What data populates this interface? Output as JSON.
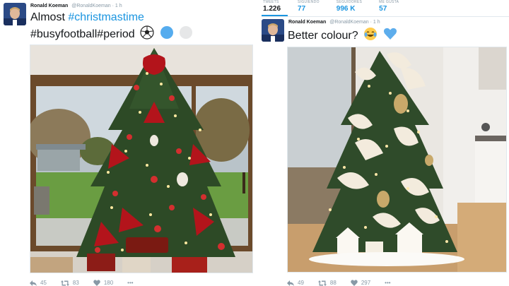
{
  "left_tweet": {
    "author_name": "Ronald Koeman",
    "author_handle": "@RonaldKoeman",
    "time": "· 1 h",
    "text_line1_plain": "Almost ",
    "text_line1_hashtag": "#christmastime",
    "text_line2": "#busyfootball#period",
    "emojis": [
      "soccer-ball-icon",
      "blue-circle-icon",
      "white-circle-icon"
    ],
    "photo": "christmas-tree-red-decor",
    "actions": {
      "replies": "45",
      "retweets": "83",
      "likes": "180",
      "more": "•••"
    }
  },
  "right_tweet": {
    "stats": [
      {
        "label": "TWEETS",
        "value": "1.226"
      },
      {
        "label": "SIGUIENDO",
        "value": "77"
      },
      {
        "label": "SEGUIDORES",
        "value": "996 K"
      },
      {
        "label": "ME GUSTA",
        "value": "57"
      }
    ],
    "author_name": "Ronald Koeman",
    "author_handle": "@RonaldKoeman",
    "time": "· 1 h",
    "text": "Better colour?",
    "emojis": [
      "tears-of-joy-icon",
      "blue-heart-icon"
    ],
    "photo": "christmas-tree-white-decor",
    "actions": {
      "replies": "49",
      "retweets": "88",
      "likes": "297",
      "more": "•••"
    }
  },
  "colors": {
    "link_blue": "#1b95e0",
    "muted_gray": "#8899a6",
    "text_dark": "#14171a",
    "everton_blue": "#274488"
  }
}
